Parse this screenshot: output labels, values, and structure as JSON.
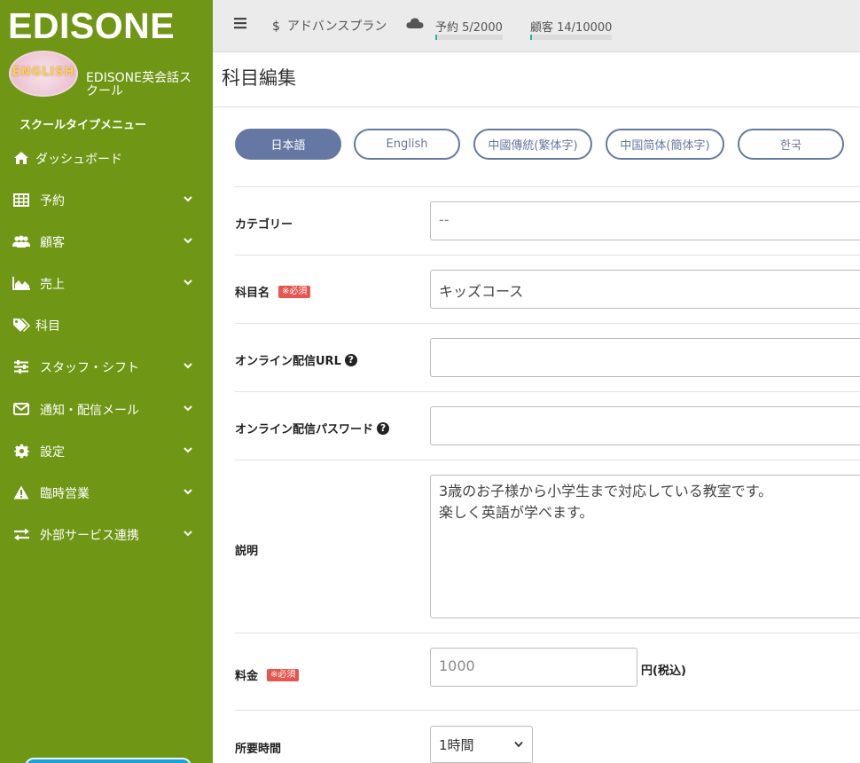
{
  "brand": {
    "logo": "EDISONE",
    "avatar_text": "ENGLISH",
    "school_name": "EDISONE英会話スクール",
    "menu_label": "スクールタイプメニュー"
  },
  "sidebar": {
    "items": [
      {
        "label": "ダッシュボード",
        "icon": "home-icon",
        "has_sub": false
      },
      {
        "label": "予約",
        "icon": "table-icon",
        "has_sub": true
      },
      {
        "label": "顧客",
        "icon": "users-icon",
        "has_sub": true
      },
      {
        "label": "売上",
        "icon": "area-chart-icon",
        "has_sub": true
      },
      {
        "label": "科目",
        "icon": "tags-icon",
        "has_sub": false
      },
      {
        "label": "スタッフ・シフト",
        "icon": "sliders-icon",
        "has_sub": true
      },
      {
        "label": "通知・配信メール",
        "icon": "envelope-icon",
        "has_sub": true
      },
      {
        "label": "設定",
        "icon": "gear-icon",
        "has_sub": true
      },
      {
        "label": "臨時営業",
        "icon": "warning-icon",
        "has_sub": true
      },
      {
        "label": "外部サービス連携",
        "icon": "exchange-icon",
        "has_sub": true
      }
    ]
  },
  "topbar": {
    "plan_symbol": "$",
    "plan": "アドバンスプラン",
    "reservations": {
      "label": "予約 5/2000",
      "used": 5,
      "limit": 2000
    },
    "customers": {
      "label": "顧客 14/10000",
      "used": 14,
      "limit": 10000
    }
  },
  "page": {
    "title": "科目編集"
  },
  "languages": [
    {
      "label": "日本語",
      "active": true
    },
    {
      "label": "English",
      "active": false
    },
    {
      "label": "中國傳統(繁体字)",
      "active": false
    },
    {
      "label": "中国简体(簡体字)",
      "active": false
    },
    {
      "label": "한국",
      "active": false
    }
  ],
  "form": {
    "category": {
      "label": "カテゴリー",
      "value": "--"
    },
    "subject_name": {
      "label": "科目名",
      "required": "※必須",
      "value": "キッズコース"
    },
    "online_url": {
      "label": "オンライン配信URL",
      "value": ""
    },
    "online_password": {
      "label": "オンライン配信パスワード",
      "value": ""
    },
    "description": {
      "label": "説明",
      "value": "3歳のお子様から小学生まで対応している教室です。\n楽しく英語が学べます。"
    },
    "fee": {
      "label": "料金",
      "required": "※必須",
      "value": "1000",
      "unit": "円(税込)"
    },
    "duration": {
      "label": "所要時間",
      "value": "1時間"
    }
  },
  "colors": {
    "sidebar": "#6f9614",
    "accent": "#6478a3",
    "required": "#e8554e",
    "progress": "#26b3a0"
  }
}
